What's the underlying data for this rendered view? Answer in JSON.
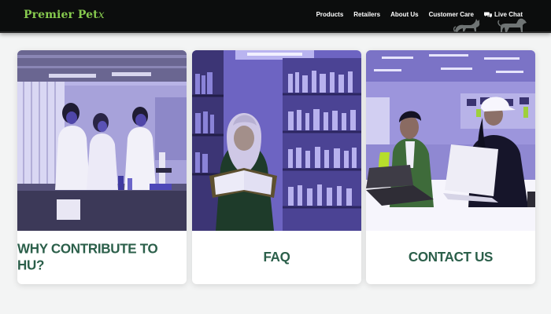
{
  "header": {
    "logo_main": "Premier Pet",
    "logo_suffix": "x",
    "nav": {
      "products": "Products",
      "retailers": "Retailers",
      "about": "About Us",
      "customer_care": "Customer Care",
      "live_chat": "Live Chat"
    }
  },
  "cards": [
    {
      "label": "WHY CONTRIBUTE TO HU?",
      "image": "lab-students-photo"
    },
    {
      "label": "FAQ",
      "image": "library-reader-photo"
    },
    {
      "label": "CONTACT US",
      "image": "students-laptop-photo"
    }
  ],
  "colors": {
    "header_bg": "#0c0d0d",
    "logo": "#86c94e",
    "card_label": "#2b5f4a",
    "page_bg": "#f3f4f4",
    "photo_tint": "#7b6fd8"
  }
}
